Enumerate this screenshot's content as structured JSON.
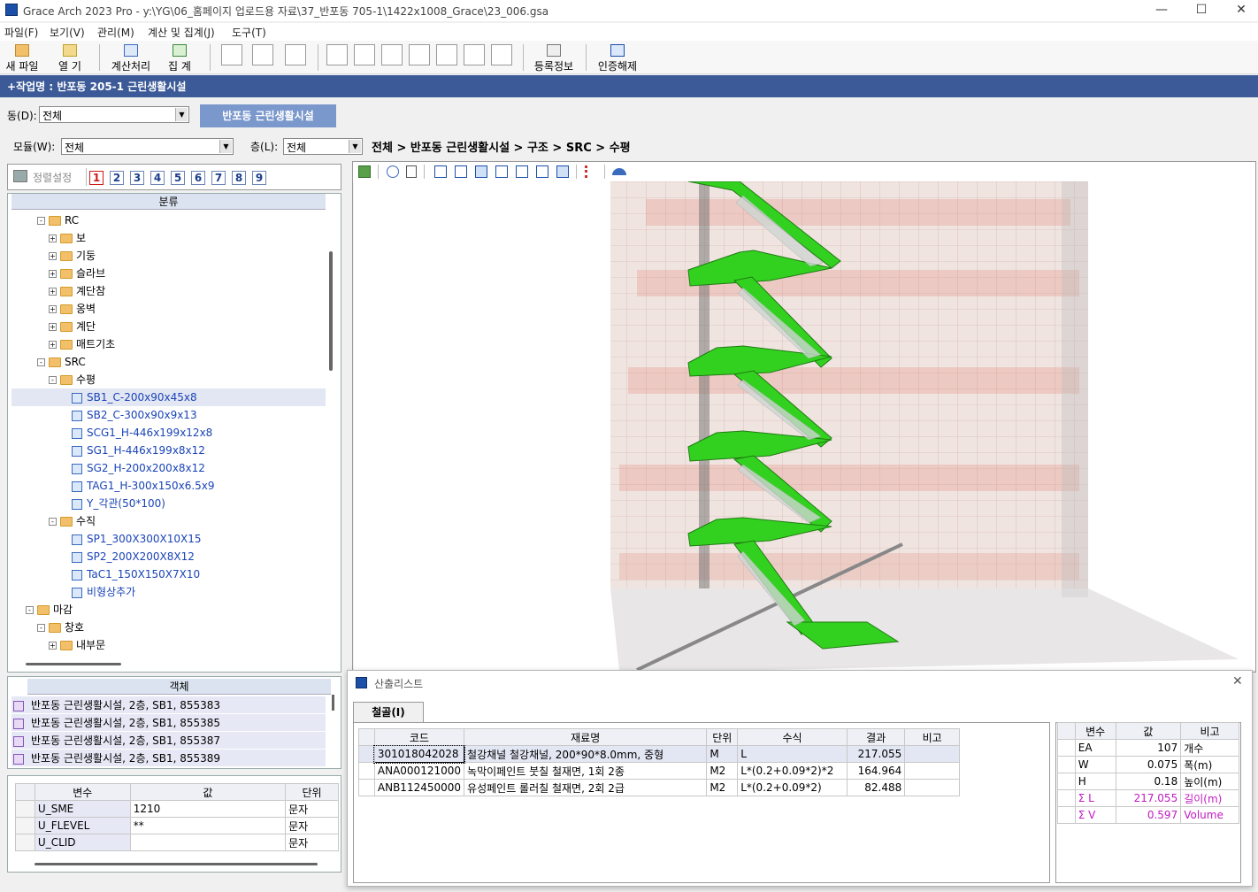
{
  "window": {
    "title": "Grace Arch 2023 Pro - y:\\YG\\06_홈페이지 업로드용 자료\\37_반포동 705-1\\1422x1008_Grace\\23_006.gsa"
  },
  "menu": [
    "파일(F)",
    "보기(V)",
    "관리(M)",
    "계산 및 집계(J)",
    "도구(T)"
  ],
  "toolbar": {
    "new_file": "새 파일",
    "open": "열  기",
    "calc": "계산처리",
    "sum": "집  계",
    "register": "등록정보",
    "unlock": "인증해제"
  },
  "project": {
    "label": "+작업명 : 반포동 205-1 근린생활시설"
  },
  "dong": {
    "label": "동(D):",
    "value": "전체",
    "tab": "반포동 근린생활시설"
  },
  "module": {
    "label": "모듈(W):",
    "value": "전체"
  },
  "floor": {
    "label": "층(L):",
    "value": "전체"
  },
  "breadcrumb": "전체 > 반포동 근린생활시설 > 구조 > SRC > 수평",
  "sort": {
    "label": "정렬설정",
    "tabs": [
      "1",
      "2",
      "3",
      "4",
      "5",
      "6",
      "7",
      "8",
      "9"
    ]
  },
  "tree": {
    "header": "분류",
    "items": [
      {
        "label": "RC",
        "level": 2,
        "type": "folder",
        "exp": "-"
      },
      {
        "label": "보",
        "level": 3,
        "type": "folder",
        "exp": "+"
      },
      {
        "label": "기둥",
        "level": 3,
        "type": "folder",
        "exp": "+"
      },
      {
        "label": "슬라브",
        "level": 3,
        "type": "folder",
        "exp": "+"
      },
      {
        "label": "계단참",
        "level": 3,
        "type": "folder",
        "exp": "+"
      },
      {
        "label": "옹벽",
        "level": 3,
        "type": "folder",
        "exp": "+"
      },
      {
        "label": "계단",
        "level": 3,
        "type": "folder",
        "exp": "+"
      },
      {
        "label": "매트기초",
        "level": 3,
        "type": "folder",
        "exp": "+"
      },
      {
        "label": "SRC",
        "level": 2,
        "type": "folder",
        "exp": "-"
      },
      {
        "label": "수평",
        "level": 3,
        "type": "folder",
        "exp": "-"
      },
      {
        "label": "SB1_C-200x90x45x8",
        "level": 4,
        "type": "leaf",
        "selected": true
      },
      {
        "label": "SB2_C-300x90x9x13",
        "level": 4,
        "type": "leaf"
      },
      {
        "label": "SCG1_H-446x199x12x8",
        "level": 4,
        "type": "leaf"
      },
      {
        "label": "SG1_H-446x199x8x12",
        "level": 4,
        "type": "leaf"
      },
      {
        "label": "SG2_H-200x200x8x12",
        "level": 4,
        "type": "leaf"
      },
      {
        "label": "TAG1_H-300x150x6.5x9",
        "level": 4,
        "type": "leaf"
      },
      {
        "label": "Y_각관(50*100)",
        "level": 4,
        "type": "leaf"
      },
      {
        "label": "수직",
        "level": 3,
        "type": "folder",
        "exp": "-"
      },
      {
        "label": "SP1_300X300X10X15",
        "level": 4,
        "type": "leaf"
      },
      {
        "label": "SP2_200X200X8X12",
        "level": 4,
        "type": "leaf"
      },
      {
        "label": "TaC1_150X150X7X10",
        "level": 4,
        "type": "leaf"
      },
      {
        "label": "비형상추가",
        "level": 4,
        "type": "leaf"
      },
      {
        "label": "마감",
        "level": 1,
        "type": "folder",
        "exp": "-"
      },
      {
        "label": "창호",
        "level": 2,
        "type": "folder",
        "exp": "-"
      },
      {
        "label": "내부문",
        "level": 3,
        "type": "folder",
        "exp": "+"
      }
    ]
  },
  "objects": {
    "header": "객체",
    "rows": [
      "반포동 근린생활시설, 2층, SB1, 855383",
      "반포동 근린생활시설, 2층, SB1, 855385",
      "반포동 근린생활시설, 2층, SB1, 855387",
      "반포동 근린생활시설, 2층, SB1, 855389"
    ]
  },
  "props": {
    "headers": [
      "변수",
      "값",
      "단위"
    ],
    "rows": [
      [
        "U_SME",
        "1210",
        "문자"
      ],
      [
        "U_FLEVEL",
        "**",
        "문자"
      ],
      [
        "U_CLID",
        "",
        "문자"
      ]
    ]
  },
  "calc_list": {
    "title": "산출리스트",
    "tab": "철골(I)",
    "headers": [
      "코드",
      "재료명",
      "단위",
      "수식",
      "결과",
      "비고"
    ],
    "rows": [
      [
        "301018042028",
        "철강채널  철강채널, 200*90*8.0mm, 중형",
        "M",
        "L",
        "217.055",
        ""
      ],
      [
        "ANA000121000",
        "녹막이페인트 붓칠  철재면, 1회 2종",
        "M2",
        "L*(0.2+0.09*2)*2",
        "164.964",
        ""
      ],
      [
        "ANB112450000",
        "유성페인트 롤러칠  철재면, 2회 2급",
        "M2",
        "L*(0.2+0.09*2)",
        "82.488",
        ""
      ]
    ]
  },
  "vars": {
    "headers": [
      "변수",
      "값",
      "비고"
    ],
    "rows": [
      {
        "name": "EA",
        "value": "107",
        "note": "개수",
        "sum": false
      },
      {
        "name": "W",
        "value": "0.075",
        "note": "폭(m)",
        "sum": false
      },
      {
        "name": "H",
        "value": "0.18",
        "note": "높이(m)",
        "sum": false
      },
      {
        "name": "Σ L",
        "value": "217.055",
        "note": "길이(m)",
        "sum": true
      },
      {
        "name": "Σ V",
        "value": "0.597",
        "note": "Volume",
        "sum": true
      }
    ]
  },
  "colors": {
    "accent": "#3c5a97",
    "highlight_green": "#33d11f",
    "sum_magenta": "#c21ac2"
  }
}
